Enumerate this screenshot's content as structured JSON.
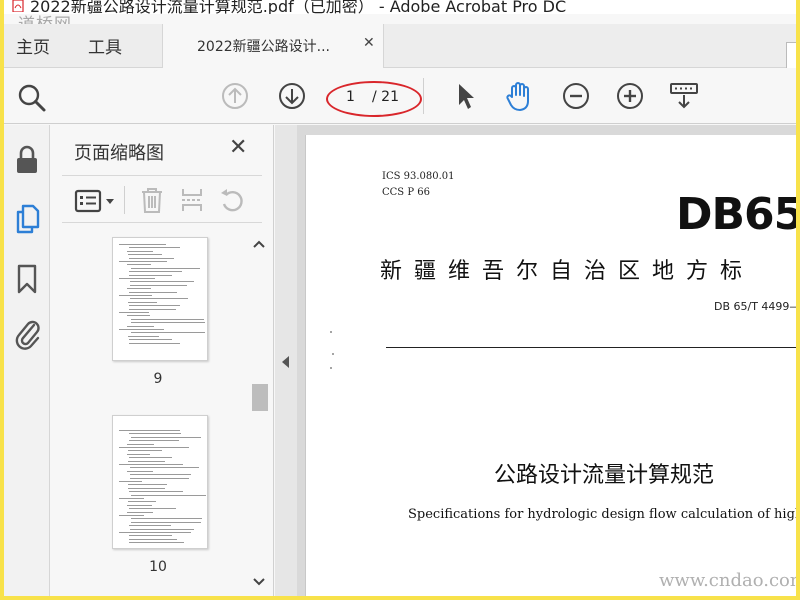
{
  "window": {
    "title": "2022新疆公路设计流量计算规范.pdf（已加密） - Adobe Acrobat Pro DC"
  },
  "watermarks": {
    "top_left": "道桥网",
    "bottom_right": "www.cndao.com"
  },
  "nav": {
    "home": "主页",
    "tools": "工具"
  },
  "doc_tab": {
    "label": "2022新疆公路设计...",
    "close": "✕"
  },
  "toolbar": {
    "current_page": "1",
    "total_pages": "/ 21",
    "icons": [
      "search-zoom-icon",
      "page-up-icon",
      "page-down-icon",
      "select-pointer-icon",
      "hand-tool-icon",
      "zoom-out-icon",
      "zoom-in-icon",
      "scroll-mode-icon"
    ],
    "accent": "#2d7fd6",
    "highlight_oval": "#d9262b"
  },
  "rail": {
    "icons": [
      "lock-icon",
      "page-thumbnails-icon",
      "bookmark-icon",
      "attachment-icon"
    ]
  },
  "thumbnail_panel": {
    "title": "页面缩略图",
    "close": "✕",
    "thumbnails": [
      {
        "page_label": "9"
      },
      {
        "page_label": "10"
      }
    ]
  },
  "document_page": {
    "ics": "ICS  93.080.01",
    "ccs": "CCS  P 66",
    "logo": "DB65",
    "standard_title": "新疆维吾尔自治区地方标",
    "standard_number": "DB 65/T 4499—",
    "chinese_title": "公路设计流量计算规范",
    "english_title": "Specifications for hydrologic design flow calculation of highway enginee"
  }
}
